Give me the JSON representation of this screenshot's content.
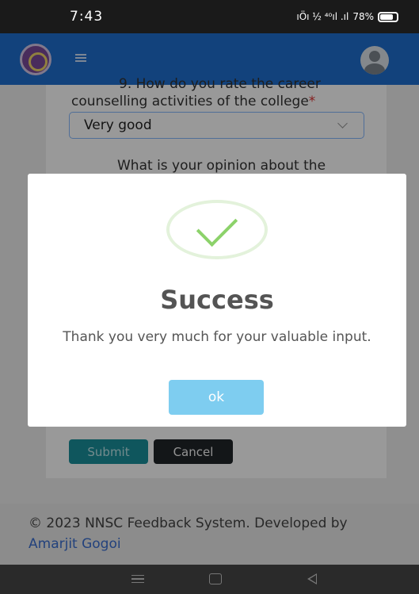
{
  "status_bar": {
    "time": "7:43",
    "network_icons": "ıÖı ½ ⁴⁰ıl .ıl",
    "battery": "78%"
  },
  "app_bar": {
    "color": "#1f6fcf"
  },
  "form": {
    "question_cut": "9. How do you rate the career",
    "question_label": "counselling activities of the college",
    "required_mark": "*",
    "selected_value": "Very good",
    "next_question_partial": "What is your opinion about the",
    "submit_label": "Submit",
    "cancel_label": "Cancel"
  },
  "modal": {
    "title": "Success",
    "message": "Thank you very much for your valuable input.",
    "ok_label": "ok"
  },
  "footer": {
    "text": "© 2023 NNSC Feedback System. Developed by",
    "author_link": "Amarjit Gogoi"
  }
}
